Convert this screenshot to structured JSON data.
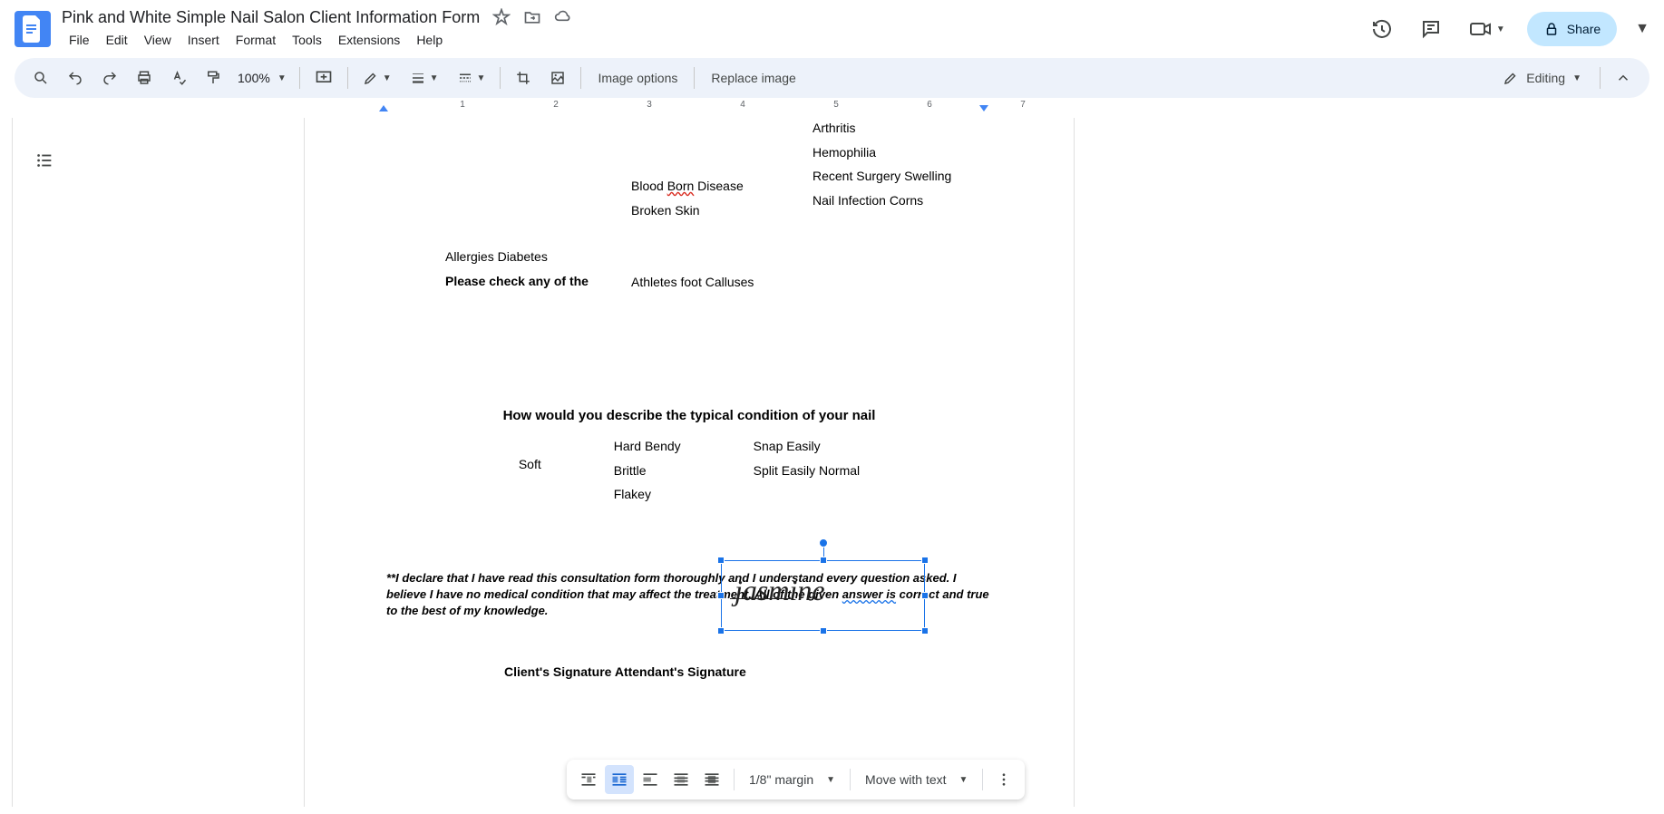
{
  "document": {
    "title": "Pink and White Simple Nail Salon Client Information Form"
  },
  "menus": {
    "file": "File",
    "edit": "Edit",
    "view": "View",
    "insert": "Insert",
    "format": "Format",
    "tools": "Tools",
    "extensions": "Extensions",
    "help": "Help"
  },
  "share": {
    "label": "Share"
  },
  "toolbar": {
    "zoom": "100%",
    "image_options": "Image options",
    "replace_image": "Replace image",
    "mode": "Editing"
  },
  "ruler": {
    "n1": "1",
    "n2": "2",
    "n3": "3",
    "n4": "4",
    "n5": "5",
    "n6": "6",
    "n7": "7"
  },
  "content": {
    "conditions": {
      "col1_line1": "Allergies Diabetes",
      "col1_heading": "Please check any of the",
      "col2_line1": "Blood ",
      "col2_line1_err": "Born",
      "col2_line1_after": " Disease",
      "col2_line2": "Broken Skin",
      "col2_line3": "Athletes foot Calluses",
      "col3_line0": "Arthritis",
      "col3_line1": "Hemophilia",
      "col3_line2": "Recent Surgery Swelling",
      "col3_line3": "Nail Infection Corns"
    },
    "question": "How would you describe the typical condition of your nail",
    "nail": {
      "c1": "Soft",
      "c2a": "Hard Bendy",
      "c2b": "Brittle",
      "c2c": "Flakey",
      "c3a": "Snap Easily",
      "c3b": "Split Easily Normal"
    },
    "declaration_p1": "**I declare that I have read this consultation form thoroughly and I understand every question asked. I believe I have no medical condition that may affect the treatment. All of the given ",
    "declaration_err": "answer is",
    "declaration_p2": " correct and true to the best of my knowledge.",
    "signatures_label": "Client's Signature Attendant's Signature",
    "signature_name": "jasmine"
  },
  "image_toolbar": {
    "margin": "1/8\" margin",
    "position": "Move with text"
  }
}
